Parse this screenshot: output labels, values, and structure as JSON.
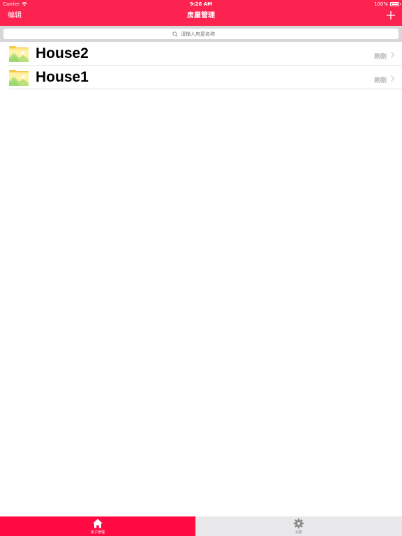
{
  "status_bar": {
    "carrier": "Carrier",
    "time": "9:26 AM",
    "battery": "100%"
  },
  "nav": {
    "edit_label": "编辑",
    "title": "房屋管理",
    "add_icon": "plus-icon"
  },
  "search": {
    "placeholder": "请输入房屋名称",
    "icon": "search-icon"
  },
  "houses": [
    {
      "name": "House2",
      "time": "刚刚",
      "icon": "folder-image-icon"
    },
    {
      "name": "House1",
      "time": "刚刚",
      "icon": "folder-image-icon"
    }
  ],
  "tabs": [
    {
      "label": "房子管理",
      "icon": "home-icon",
      "selected": true
    },
    {
      "label": "设置",
      "icon": "gear-icon",
      "selected": false
    }
  ],
  "colors": {
    "accent": "#fd2350",
    "tab_selected": "#ff0a43",
    "tab_bar": "#e8e8ea",
    "search_bar": "#d6d6db"
  }
}
